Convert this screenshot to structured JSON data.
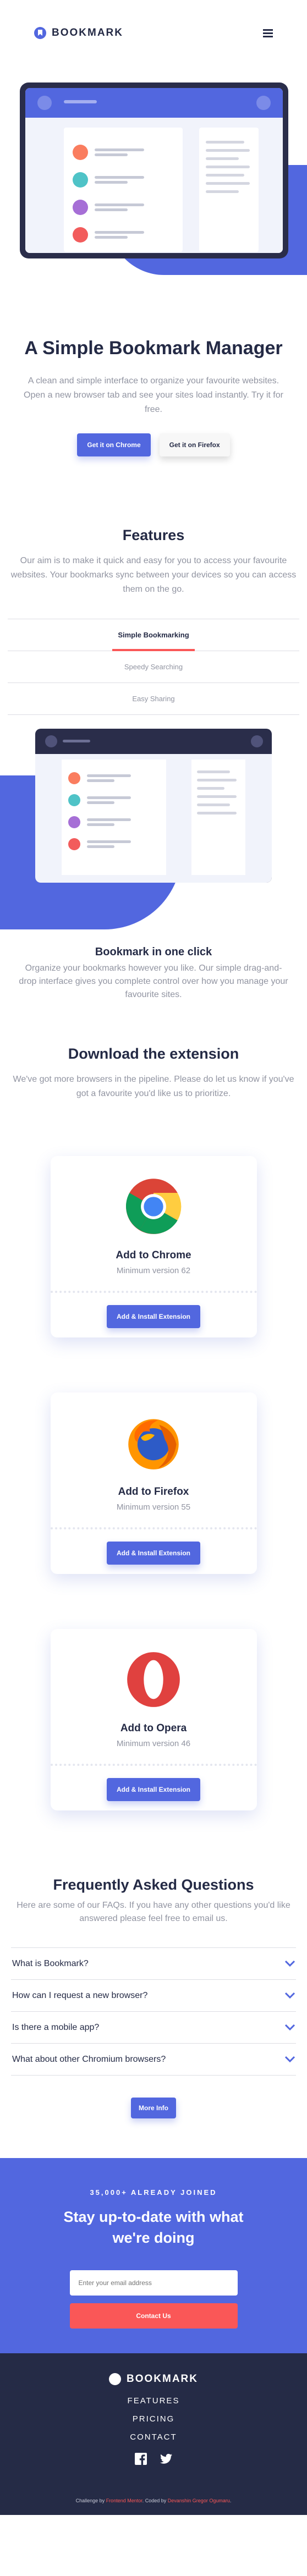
{
  "header": {
    "logo_text": "BOOKMARK"
  },
  "hero": {
    "title": "A Simple Bookmark Manager",
    "description": "A clean and simple interface to organize your favourite websites. Open a new browser tab and see your sites load instantly. Try it for free.",
    "chrome_button": "Get it on Chrome",
    "firefox_button": "Get it on Firefox"
  },
  "features": {
    "title": "Features",
    "description": "Our aim is to make it quick and easy for you to access your favourite websites. Your bookmarks sync between your devices so you can access them on the go.",
    "tabs": [
      "Simple Bookmarking",
      "Speedy Searching",
      "Easy Sharing"
    ],
    "active_tab": "Simple Bookmarking",
    "active_title": "Bookmark in one click",
    "active_description": "Organize your bookmarks however you like. Our simple drag-and-drop interface gives you complete control over how you manage your favourite sites."
  },
  "download": {
    "title": "Download the extension",
    "description": "We've got more browsers in the pipeline. Please do let us know if you've got a favourite you'd like us to prioritize.",
    "cards": [
      {
        "name": "Add to Chrome",
        "version": "Minimum version 62",
        "button": "Add & Install Extension",
        "icon": "chrome-logo"
      },
      {
        "name": "Add to Firefox",
        "version": "Minimum version 55",
        "button": "Add & Install Extension",
        "icon": "firefox-logo"
      },
      {
        "name": "Add to Opera",
        "version": "Minimum version 46",
        "button": "Add & Install Extension",
        "icon": "opera-logo"
      }
    ]
  },
  "faq": {
    "title": "Frequently Asked Questions",
    "description": "Here are some of our FAQs. If you have any other questions you'd like answered please feel free to email us.",
    "items": [
      "What is Bookmark?",
      "How can I request a new browser?",
      "Is there a mobile app?",
      "What about other Chromium browsers?"
    ],
    "more_button": "More Info"
  },
  "newsletter": {
    "joined": "35,000+ ALREADY JOINED",
    "title": "Stay up-to-date with what we're doing",
    "placeholder": "Enter your email address",
    "button": "Contact Us"
  },
  "footer": {
    "logo_text": "BOOKMARK",
    "nav": [
      "FEATURES",
      "PRICING",
      "CONTACT"
    ],
    "attribution_prefix": "Challenge by",
    "attribution_link1": "Frontend Mentor",
    "attribution_mid": ". Coded by",
    "attribution_link2": "Devanshin Gregor Ogumaru",
    "attribution_suffix": "."
  },
  "colors": {
    "accent": "#5267df",
    "red": "#fa5757",
    "dark": "#242a45",
    "muted": "#9194a1"
  }
}
